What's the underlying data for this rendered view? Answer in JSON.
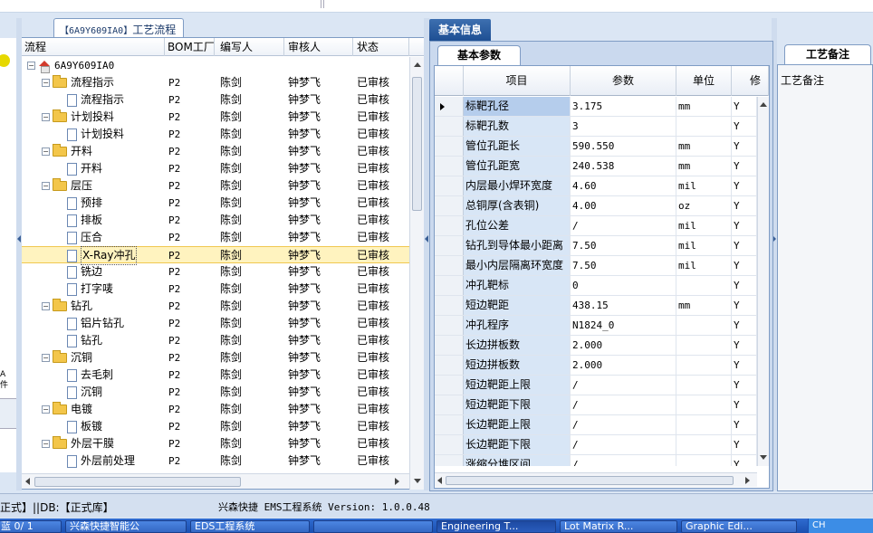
{
  "tree_panel": {
    "tab_code": "【6A9Y609IA0】",
    "tab_label": "工艺流程",
    "columns": [
      "流程",
      "BOM工厂",
      "编写人",
      "审核人",
      "状态"
    ],
    "rows": [
      {
        "level": 0,
        "type": "root",
        "name": "6A9Y609IA0",
        "bom": "",
        "writer": "",
        "reviewer": "",
        "status": ""
      },
      {
        "level": 1,
        "type": "folder",
        "name": "流程指示",
        "bom": "P2",
        "writer": "陈剑",
        "reviewer": "钟梦飞",
        "status": "已审核"
      },
      {
        "level": 2,
        "type": "doc",
        "name": "流程指示",
        "bom": "P2",
        "writer": "陈剑",
        "reviewer": "钟梦飞",
        "status": "已审核"
      },
      {
        "level": 1,
        "type": "folder",
        "name": "计划投料",
        "bom": "P2",
        "writer": "陈剑",
        "reviewer": "钟梦飞",
        "status": "已审核"
      },
      {
        "level": 2,
        "type": "doc",
        "name": "计划投料",
        "bom": "P2",
        "writer": "陈剑",
        "reviewer": "钟梦飞",
        "status": "已审核"
      },
      {
        "level": 1,
        "type": "folder",
        "name": "开料",
        "bom": "P2",
        "writer": "陈剑",
        "reviewer": "钟梦飞",
        "status": "已审核"
      },
      {
        "level": 2,
        "type": "doc",
        "name": "开料",
        "bom": "P2",
        "writer": "陈剑",
        "reviewer": "钟梦飞",
        "status": "已审核"
      },
      {
        "level": 1,
        "type": "folder",
        "name": "层压",
        "bom": "P2",
        "writer": "陈剑",
        "reviewer": "钟梦飞",
        "status": "已审核"
      },
      {
        "level": 2,
        "type": "doc",
        "name": "预排",
        "bom": "P2",
        "writer": "陈剑",
        "reviewer": "钟梦飞",
        "status": "已审核"
      },
      {
        "level": 2,
        "type": "doc",
        "name": "排板",
        "bom": "P2",
        "writer": "陈剑",
        "reviewer": "钟梦飞",
        "status": "已审核"
      },
      {
        "level": 2,
        "type": "doc",
        "name": "压合",
        "bom": "P2",
        "writer": "陈剑",
        "reviewer": "钟梦飞",
        "status": "已审核"
      },
      {
        "level": 2,
        "type": "doc",
        "name": "X-Ray冲孔",
        "bom": "P2",
        "writer": "陈剑",
        "reviewer": "钟梦飞",
        "status": "已审核",
        "selected": true
      },
      {
        "level": 2,
        "type": "doc",
        "name": "铣边",
        "bom": "P2",
        "writer": "陈剑",
        "reviewer": "钟梦飞",
        "status": "已审核"
      },
      {
        "level": 2,
        "type": "doc",
        "name": "打字唛",
        "bom": "P2",
        "writer": "陈剑",
        "reviewer": "钟梦飞",
        "status": "已审核"
      },
      {
        "level": 1,
        "type": "folder",
        "name": "钻孔",
        "bom": "P2",
        "writer": "陈剑",
        "reviewer": "钟梦飞",
        "status": "已审核"
      },
      {
        "level": 2,
        "type": "doc",
        "name": "铝片钻孔",
        "bom": "P2",
        "writer": "陈剑",
        "reviewer": "钟梦飞",
        "status": "已审核"
      },
      {
        "level": 2,
        "type": "doc",
        "name": "钻孔",
        "bom": "P2",
        "writer": "陈剑",
        "reviewer": "钟梦飞",
        "status": "已审核"
      },
      {
        "level": 1,
        "type": "folder",
        "name": "沉铜",
        "bom": "P2",
        "writer": "陈剑",
        "reviewer": "钟梦飞",
        "status": "已审核"
      },
      {
        "level": 2,
        "type": "doc",
        "name": "去毛刺",
        "bom": "P2",
        "writer": "陈剑",
        "reviewer": "钟梦飞",
        "status": "已审核"
      },
      {
        "level": 2,
        "type": "doc",
        "name": "沉铜",
        "bom": "P2",
        "writer": "陈剑",
        "reviewer": "钟梦飞",
        "status": "已审核"
      },
      {
        "level": 1,
        "type": "folder",
        "name": "电镀",
        "bom": "P2",
        "writer": "陈剑",
        "reviewer": "钟梦飞",
        "status": "已审核"
      },
      {
        "level": 2,
        "type": "doc",
        "name": "板镀",
        "bom": "P2",
        "writer": "陈剑",
        "reviewer": "钟梦飞",
        "status": "已审核"
      },
      {
        "level": 1,
        "type": "folder",
        "name": "外层干膜",
        "bom": "P2",
        "writer": "陈剑",
        "reviewer": "钟梦飞",
        "status": "已审核"
      },
      {
        "level": 2,
        "type": "doc",
        "name": "外层前处理",
        "bom": "P2",
        "writer": "陈剑",
        "reviewer": "钟梦飞",
        "status": "已审核"
      }
    ]
  },
  "info_panel": {
    "tab_label": "基本信息",
    "sub_tab_label": "基本参数",
    "columns": [
      "项目",
      "参数",
      "单位",
      "修"
    ],
    "rows": [
      {
        "name": "标靶孔径",
        "value": "3.175",
        "unit": "mm",
        "flag": "Y",
        "selected": true
      },
      {
        "name": "标靶孔数",
        "value": "3",
        "unit": "",
        "flag": "Y"
      },
      {
        "name": "管位孔距长",
        "value": "590.550",
        "unit": "mm",
        "flag": "Y"
      },
      {
        "name": "管位孔距宽",
        "value": "240.538",
        "unit": "mm",
        "flag": "Y"
      },
      {
        "name": "内层最小焊环宽度",
        "value": "4.60",
        "unit": "mil",
        "flag": "Y"
      },
      {
        "name": "总铜厚(含表铜)",
        "value": "4.00",
        "unit": "oz",
        "flag": "Y"
      },
      {
        "name": "孔位公差",
        "value": "/",
        "unit": "mil",
        "flag": "Y"
      },
      {
        "name": "钻孔到导体最小距离",
        "value": "7.50",
        "unit": "mil",
        "flag": "Y"
      },
      {
        "name": "最小内层隔离环宽度",
        "value": "7.50",
        "unit": "mil",
        "flag": "Y"
      },
      {
        "name": "冲孔靶标",
        "value": "0",
        "unit": "",
        "flag": "Y"
      },
      {
        "name": "短边靶距",
        "value": "438.15",
        "unit": "mm",
        "flag": "Y"
      },
      {
        "name": "冲孔程序",
        "value": "N1824_0",
        "unit": "",
        "flag": "Y"
      },
      {
        "name": "长边拼板数",
        "value": "2.000",
        "unit": "",
        "flag": "Y"
      },
      {
        "name": "短边拼板数",
        "value": "2.000",
        "unit": "",
        "flag": "Y"
      },
      {
        "name": "短边靶距上限",
        "value": "/",
        "unit": "",
        "flag": "Y"
      },
      {
        "name": "短边靶距下限",
        "value": "/",
        "unit": "",
        "flag": "Y"
      },
      {
        "name": "长边靶距上限",
        "value": "/",
        "unit": "",
        "flag": "Y"
      },
      {
        "name": "长边靶距下限",
        "value": "/",
        "unit": "",
        "flag": "Y"
      },
      {
        "name": "涨缩分堆区间",
        "value": "/",
        "unit": "",
        "flag": "Y"
      }
    ]
  },
  "notes_panel": {
    "tab_label": "工艺备注",
    "field_label": "工艺备注"
  },
  "left_edge": {
    "label": "A\n件"
  },
  "status_bar": {
    "left": "正式】||DB:【正式库】",
    "center": "兴森快捷 EMS工程系统 Version: 1.0.0.48"
  },
  "taskbar": {
    "items": [
      "蓝 0/ 1",
      "兴森快捷智能公",
      "EDS工程系统",
      "",
      "Engineering T...",
      "Lot Matrix R...",
      "Graphic Edi..."
    ],
    "tray_text": "CH"
  },
  "colors": {
    "accent": "#1e4f93",
    "selection": "#fff3bf",
    "grid_name_bg": "#d8e6f6"
  }
}
